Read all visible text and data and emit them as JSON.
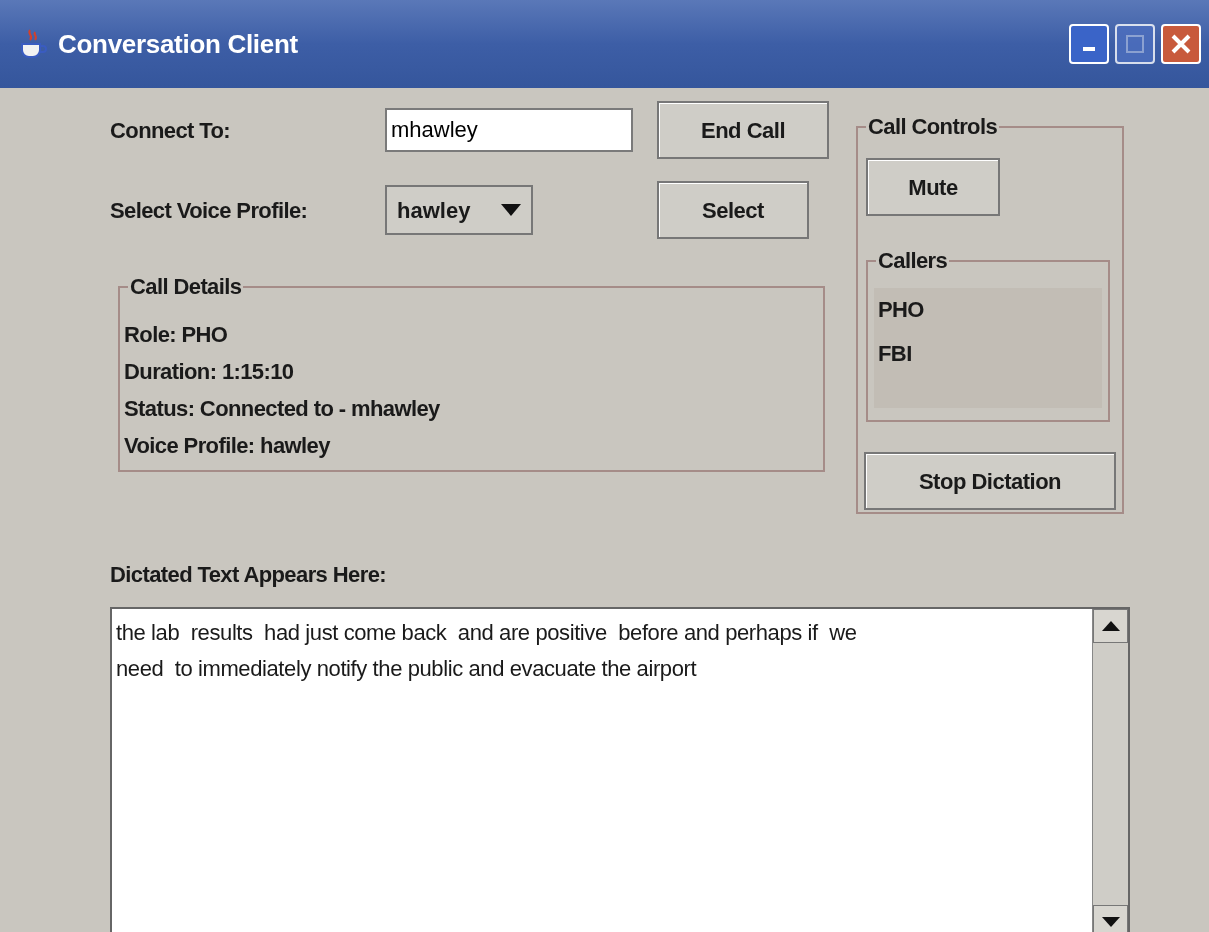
{
  "window": {
    "title": "Conversation Client"
  },
  "connect": {
    "label": "Connect To:",
    "value": "mhawley",
    "button": "End Call"
  },
  "profile": {
    "label": "Select Voice Profile:",
    "value": "hawley",
    "button": "Select"
  },
  "call_details": {
    "title": "Call Details",
    "lines": [
      "Role: PHO",
      "Duration: 1:15:10",
      "Status: Connected to - mhawley",
      "Voice Profile: hawley"
    ]
  },
  "call_controls": {
    "title": "Call Controls",
    "mute_button": "Mute",
    "callers": {
      "title": "Callers",
      "items": [
        "PHO",
        "FBI"
      ]
    },
    "stop_button": "Stop Dictation"
  },
  "dictation": {
    "label": "Dictated Text Appears Here:",
    "lines": [
      "the lab  results  had just come back  and are positive  before and perhaps if  we",
      "need  to immediately notify the public and evacuate the airport"
    ]
  }
}
